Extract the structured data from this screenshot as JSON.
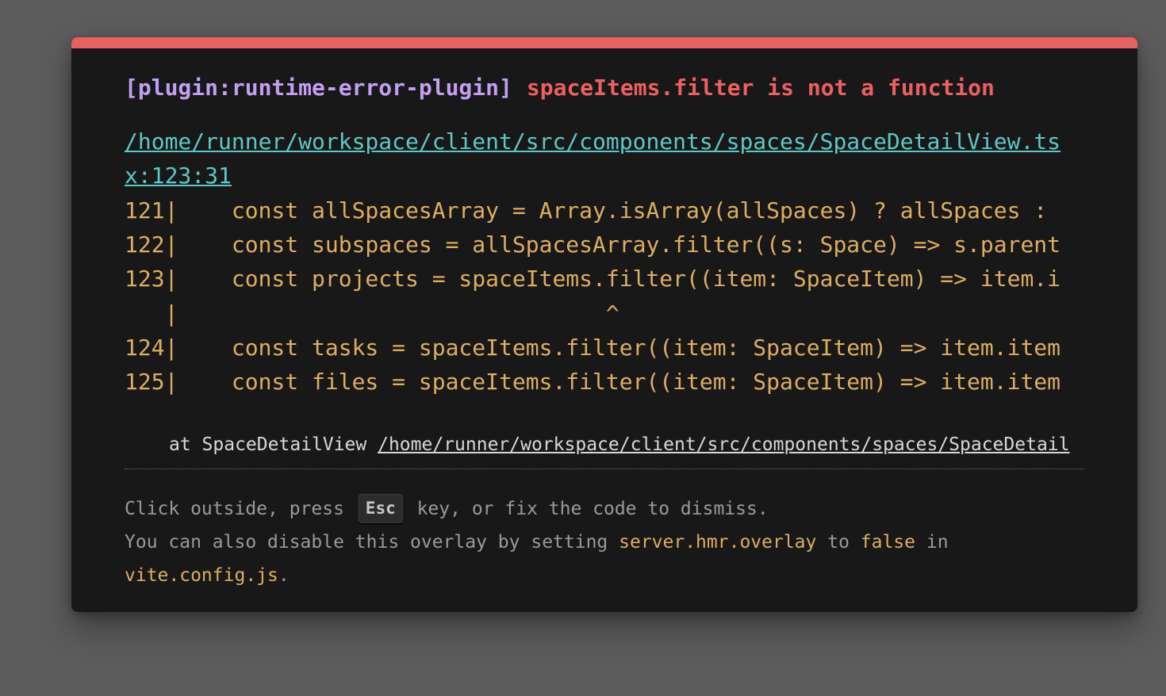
{
  "overlay": {
    "plugin": "[plugin:runtime-error-plugin]",
    "message": "spaceItems.filter is not a function",
    "file": "/home/runner/workspace/client/src/components/spaces/SpaceDetailView.tsx:123:31",
    "frame": [
      "121|    const allSpacesArray = Array.isArray(allSpaces) ? allSpaces : ",
      "122|    const subspaces = allSpacesArray.filter((s: Space) => s.parent",
      "123|    const projects = spaceItems.filter((item: SpaceItem) => item.i",
      "   |                                ^",
      "124|    const tasks = spaceItems.filter((item: SpaceItem) => item.item",
      "125|    const files = spaceItems.filter((item: SpaceItem) => item.item"
    ],
    "stack_prefix": "at SpaceDetailView ",
    "stack_link": "/home/runner/workspace/client/src/components/spaces/SpaceDetail",
    "tip": {
      "part1": "Click outside, press ",
      "key": "Esc",
      "part2": " key, or fix the code to dismiss.",
      "part3": "You can also disable this overlay by setting ",
      "code1": "server.hmr.overlay",
      "part4": " to ",
      "code2": "false",
      "part5": " in ",
      "code3": "vite.config.js",
      "part6": "."
    }
  },
  "colors": {
    "accent_bar": "#e9605f",
    "plugin": "#c39ff2",
    "message": "#ee5f5f",
    "file_link": "#5dc8c8",
    "code": "#ddae5f",
    "background": "#181818"
  }
}
